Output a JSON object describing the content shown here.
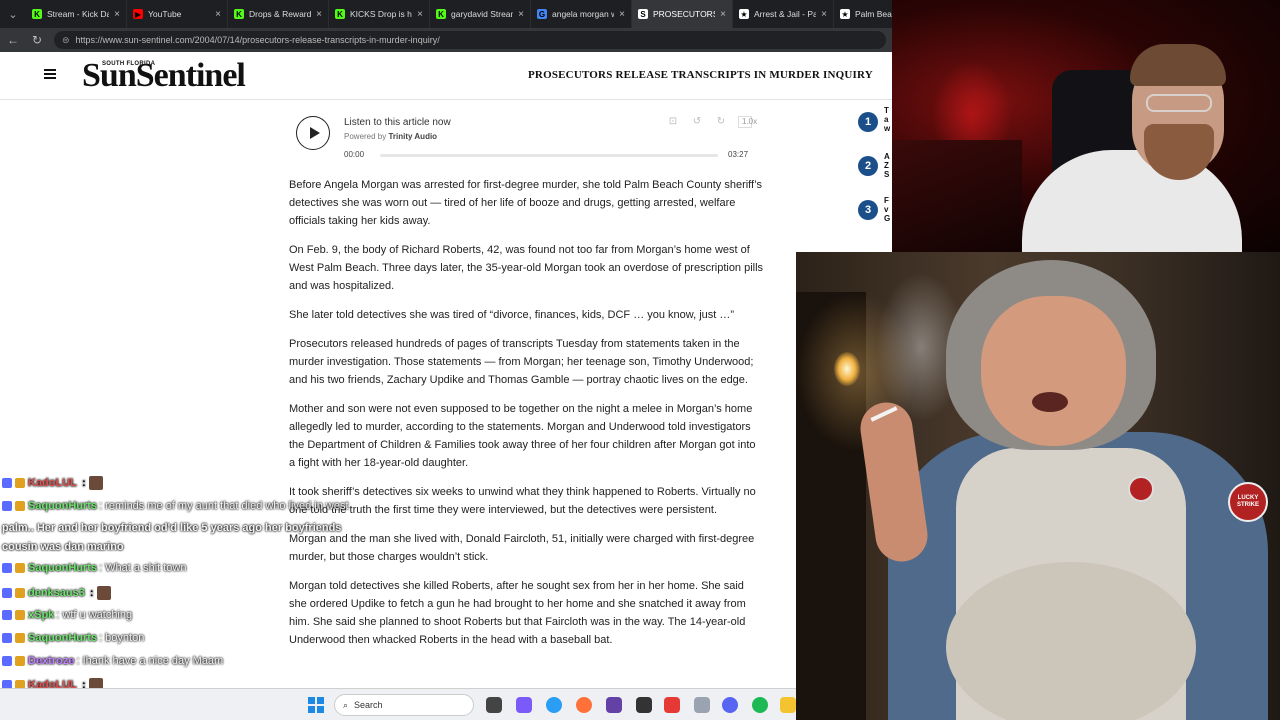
{
  "tabs": [
    {
      "title": "Stream - Kick Das",
      "fav_color": "#53fc18",
      "fav_char": "K",
      "active": false
    },
    {
      "title": "YouTube",
      "fav_color": "#ff0000",
      "fav_char": "▶",
      "active": false
    },
    {
      "title": "Drops & Rewards",
      "fav_color": "#53fc18",
      "fav_char": "K",
      "active": false
    },
    {
      "title": "KICKS Drop is her",
      "fav_color": "#53fc18",
      "fav_char": "K",
      "active": false
    },
    {
      "title": "garydavid Stream",
      "fav_color": "#53fc18",
      "fav_char": "K",
      "active": false
    },
    {
      "title": "angela morgan w",
      "fav_color": "#4285f4",
      "fav_char": "G",
      "active": false
    },
    {
      "title": "PROSECUTORS R",
      "fav_color": "#ffffff",
      "fav_char": "S",
      "active": true
    },
    {
      "title": "Arrest & Jail - Pal",
      "fav_color": "#ffffff",
      "fav_char": "★",
      "active": false
    },
    {
      "title": "Palm Beach",
      "fav_color": "#ffffff",
      "fav_char": "★",
      "active": false
    }
  ],
  "address": {
    "url": "https://www.sun-sentinel.com/2004/07/14/prosecutors-release-transcripts-in-murder-inquiry/"
  },
  "site": {
    "logo_top": "SOUTH FLORIDA",
    "logo": "SunSentinel",
    "headline": "PROSECUTORS RELEASE TRANSCRIPTS IN MURDER INQUIRY"
  },
  "player": {
    "listen": "Listen to this article now",
    "powered_prefix": "Powered by ",
    "powered_brand": "Trinity Audio",
    "time_start": "00:00",
    "time_end": "03:27",
    "speed": "1.0x",
    "progress": 0
  },
  "article": {
    "paragraphs": [
      "Before Angela Morgan was arrested for first-degree murder, she told Palm Beach County sheriff’s detectives she was worn out — tired of her life of booze and drugs, getting arrested, welfare officials taking her kids away.",
      "On Feb. 9, the body of Richard Roberts, 42, was found not too far from Morgan’s home west of West Palm Beach. Three days later, the 35-year-old Morgan took an overdose of prescription pills and was hospitalized.",
      "She later told detectives she was tired of “divorce, finances, kids, DCF … you know, just …”",
      "Prosecutors released hundreds of pages of transcripts Tuesday from statements taken in the murder investigation. Those statements — from Morgan; her teenage son, Timothy Underwood; and his two friends, Zachary Updike and Thomas Gamble — portray chaotic lives on the edge.",
      "Mother and son were not even supposed to be together on the night a melee in Morgan’s home allegedly led to murder, according to the statements. Morgan and Underwood told investigators the Department of Children & Families took away three of her four children after Morgan got into a fight with her 18-year-old daughter.",
      "It took sheriff’s detectives six weeks to unwind what they think happened to Roberts. Virtually no one told the truth the first time they were interviewed, but the detectives were persistent.",
      "Morgan and the man she lived with, Donald Faircloth, 51, initially were charged with first-degree murder, but those charges wouldn’t stick.",
      "Morgan told detectives she killed Roberts, after he sought sex from her in her home. She said she ordered Updike to fetch a gun he had brought to her home and she snatched it away from him. She said she planned to shoot Roberts but that Faircloth was in the way. The 14-year-old Underwood then whacked Roberts in the head with a baseball bat."
    ]
  },
  "trending": [
    {
      "rank": "1",
      "text": "T a w"
    },
    {
      "rank": "2",
      "text": "A Z S"
    },
    {
      "rank": "3",
      "text": "F v G"
    }
  ],
  "chat": {
    "lines": [
      {
        "user": "KadoLUL",
        "color": "#e05050",
        "msg": "",
        "emote": true
      },
      {
        "user": "SaquonHurts",
        "color": "#6ee36e",
        "msg": ": reminds me of my aunt that died who lived in west",
        "emote": false
      },
      {
        "user": "SaquonHurts",
        "color": "#6ee36e",
        "msg": ": What a shit town",
        "emote": false
      },
      {
        "user": "denksaus3",
        "color": "#6ee36e",
        "msg": "",
        "emote": true
      },
      {
        "user": "xSpk",
        "color": "#6ee36e",
        "msg": ": wtf u watching",
        "emote": false
      },
      {
        "user": "SaquonHurts",
        "color": "#6ee36e",
        "msg": ": boynton",
        "emote": false
      },
      {
        "user": "Dextroze",
        "color": "#c080ff",
        "msg": ": Ihank have a nice day Maam",
        "emote": false
      },
      {
        "user": "KadoLUL",
        "color": "#e05050",
        "msg": "",
        "emote": true
      },
      {
        "user": "KadoLUL",
        "color": "#e05050",
        "msg": "",
        "emote": true
      }
    ],
    "wrap_1": "palm.. Her and her boyfriend od'd like 5 years ago her boyfriends",
    "wrap_2": "cousin was dan marino"
  },
  "taskbar": {
    "search_placeholder": "Search"
  },
  "image_panel": {
    "patch_text": "LUCKY STRIKE"
  },
  "colors": {
    "chrome_dark": "#1e1f22",
    "chrome_tab_active": "#35363a",
    "rank_blue": "#1a4f8a",
    "kick_green": "#53fc18"
  }
}
